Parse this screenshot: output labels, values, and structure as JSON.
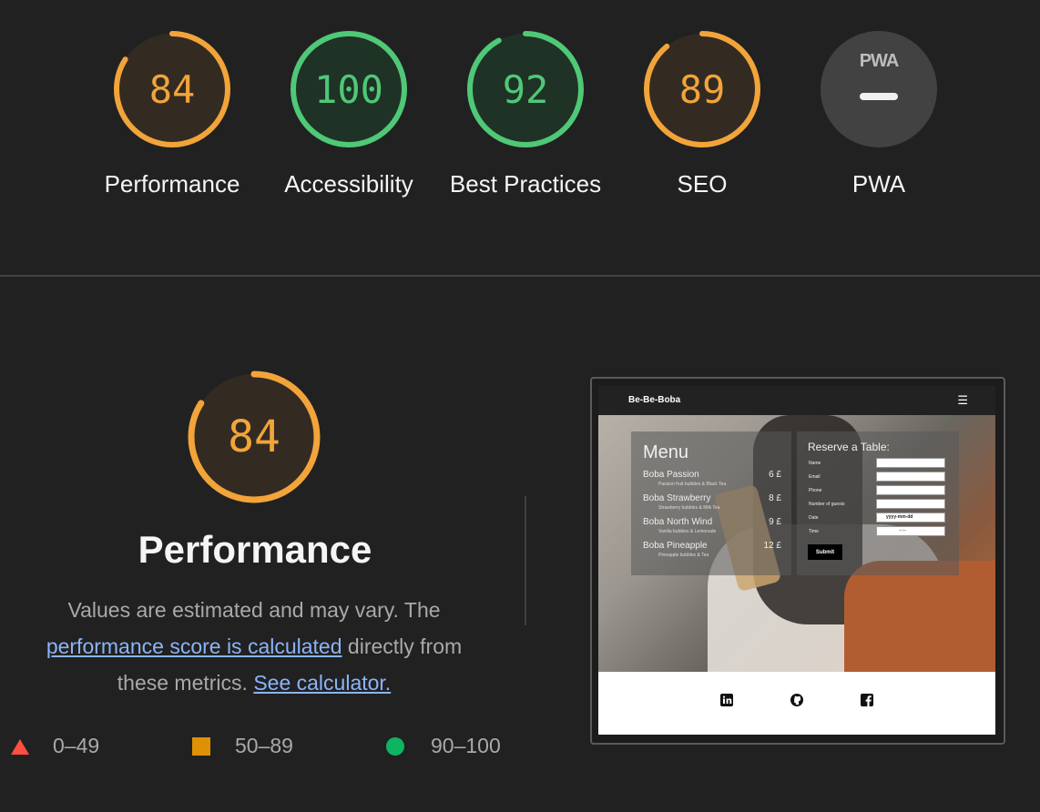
{
  "colors": {
    "orange": "#ffa400",
    "green": "#0cce6b",
    "red": "#ff4e42",
    "link": "#8ab4f8"
  },
  "scores": [
    {
      "label": "Performance",
      "value": "84",
      "score": 84,
      "color": "orange"
    },
    {
      "label": "Accessibility",
      "value": "100",
      "score": 100,
      "color": "green"
    },
    {
      "label": "Best Practices",
      "value": "92",
      "score": 92,
      "color": "green"
    },
    {
      "label": "SEO",
      "value": "89",
      "score": 89,
      "color": "orange"
    },
    {
      "label": "PWA",
      "value": "",
      "score": null,
      "color": "gray",
      "badge": "PWA",
      "icon": "pwa-icon"
    }
  ],
  "detail": {
    "score": "84",
    "title": "Performance",
    "desc_before": "Values are estimated and may vary. The ",
    "link1": "performance score is calculated",
    "desc_middle": " directly from these metrics. ",
    "link2": "See calculator."
  },
  "legend": [
    {
      "range": "0–49",
      "icon": "triangle-icon"
    },
    {
      "range": "50–89",
      "icon": "square-icon"
    },
    {
      "range": "90–100",
      "icon": "circle-icon"
    }
  ],
  "screenshot": {
    "brand": "Be-Be-Boba",
    "menu_title": "Menu",
    "menu_items": [
      {
        "name": "Boba Passion",
        "price": "6 £",
        "desc": "Passion fruit bubbles & Black Tea"
      },
      {
        "name": "Boba Strawberry",
        "price": "8 £",
        "desc": "Strawberry bubbles & Milk Tea"
      },
      {
        "name": "Boba North Wind",
        "price": "9 £",
        "desc": "Vanilla bubbles & Lemonade"
      },
      {
        "name": "Boba Pineapple",
        "price": "12 £",
        "desc": "Pineapple bubbles & Tea"
      }
    ],
    "form_title": "Reserve a Table:",
    "form_labels": [
      "Name",
      "Email",
      "Phone",
      "Number of guests",
      "Date",
      "Time"
    ],
    "date_placeholder": "yyyy-mm-dd",
    "time_placeholder": "--:--",
    "submit": "Submit"
  }
}
